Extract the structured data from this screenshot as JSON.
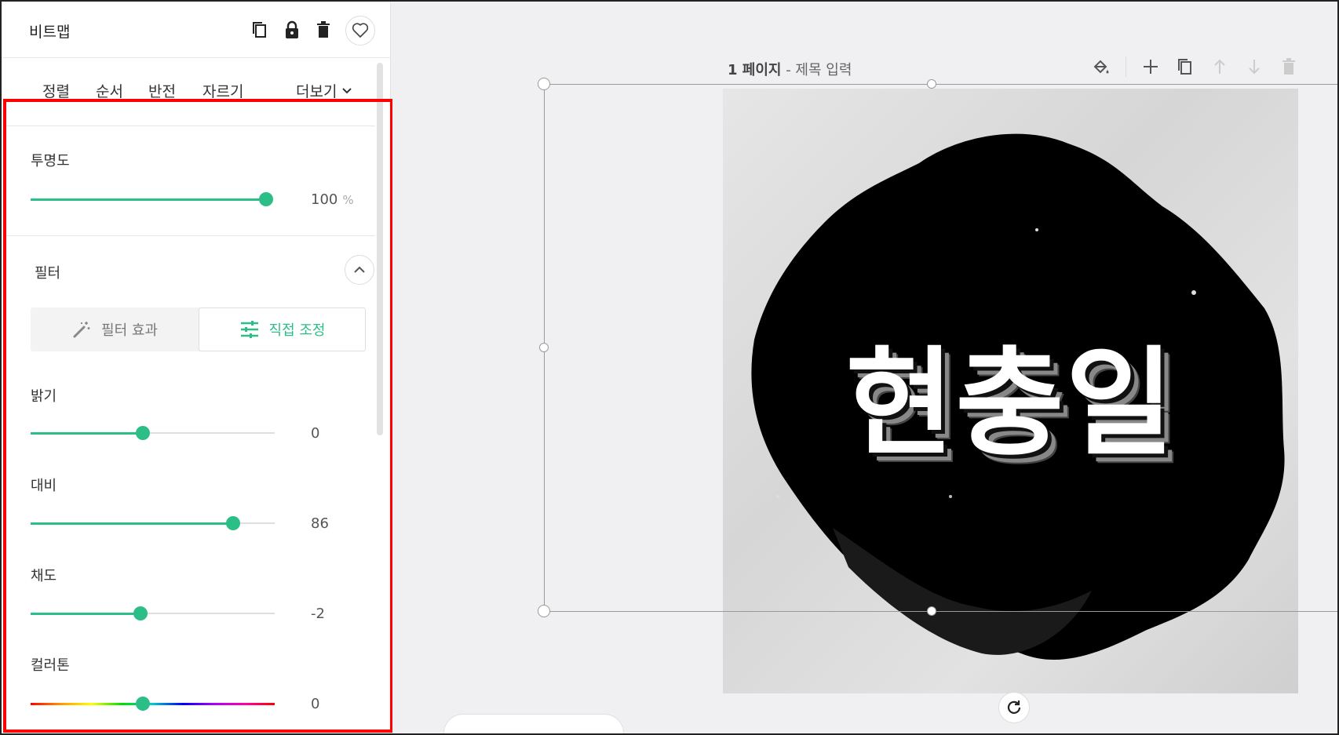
{
  "panel": {
    "title": "비트맵",
    "tabs": [
      "정렬",
      "순서",
      "반전",
      "자르기"
    ],
    "more_label": "더보기",
    "opacity": {
      "label": "투명도",
      "value": "100",
      "unit": "%",
      "level": 1.0
    },
    "filter": {
      "label": "필터",
      "toggle_effects": "필터 효과",
      "toggle_manual": "직접 조정",
      "active_toggle": "직접 조정"
    },
    "adjust": {
      "brightness": {
        "label": "밝기",
        "value": "0",
        "level": 0.5
      },
      "contrast": {
        "label": "대비",
        "value": "86",
        "level": 0.9
      },
      "saturation": {
        "label": "채도",
        "value": "-2",
        "level": 0.49
      },
      "colortone": {
        "label": "컬러톤",
        "value": "0",
        "level": 0.5
      }
    }
  },
  "canvas": {
    "page_number": "1 페이지",
    "page_title_placeholder": "- 제목 입력",
    "headline": "현충일"
  },
  "colors": {
    "accent": "#2bbf87",
    "highlight": "#ff0000"
  },
  "icons": {
    "header": [
      "copy-icon",
      "lock-icon",
      "trash-icon",
      "heart-icon"
    ],
    "page_tools": [
      "paint-bucket-icon",
      "plus-icon",
      "duplicate-icon",
      "arrow-up-icon",
      "arrow-down-icon",
      "trash-icon"
    ]
  }
}
